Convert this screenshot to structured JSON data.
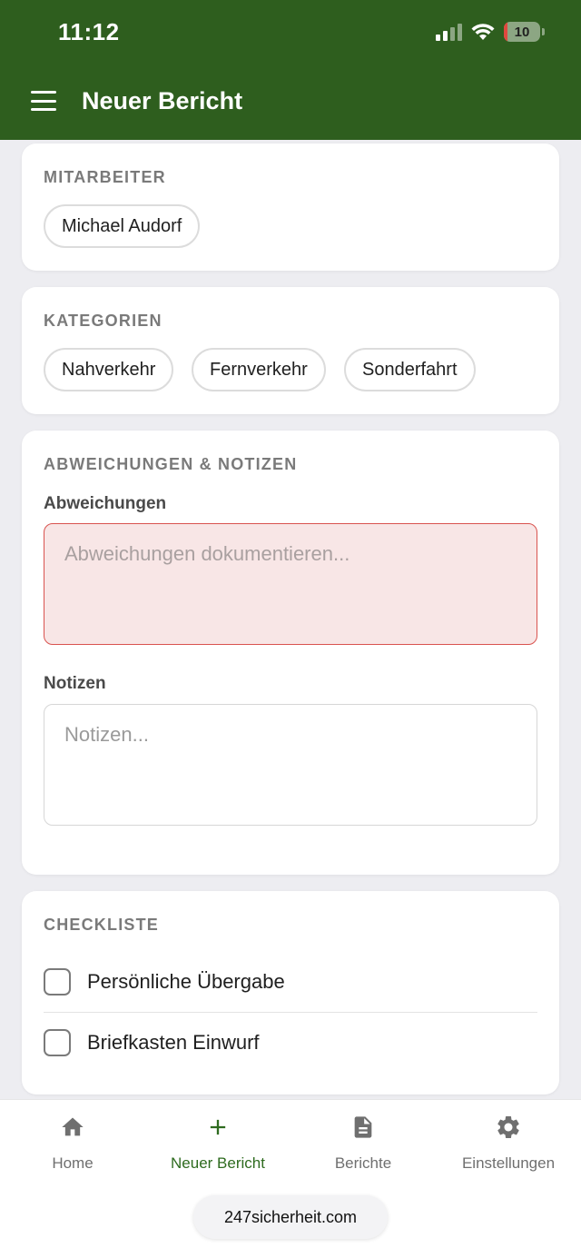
{
  "status_bar": {
    "time": "11:12",
    "battery": "10"
  },
  "header": {
    "title": "Neuer Bericht"
  },
  "mitarbeiter": {
    "title": "MITARBEITER",
    "chips": [
      "Michael Audorf"
    ]
  },
  "kategorien": {
    "title": "KATEGORIEN",
    "chips": [
      "Nahverkehr",
      "Fernverkehr",
      "Sonderfahrt"
    ]
  },
  "abweichungen_notizen": {
    "title": "ABWEICHUNGEN & NOTIZEN",
    "abweichungen_label": "Abweichungen",
    "abweichungen_placeholder": "Abweichungen dokumentieren...",
    "notizen_label": "Notizen",
    "notizen_placeholder": "Notizen..."
  },
  "checkliste": {
    "title": "CHECKLISTE",
    "items": [
      "Persönliche Übergabe",
      "Briefkasten Einwurf"
    ]
  },
  "tabbar": {
    "tabs": [
      {
        "label": "Home",
        "icon": "home-icon"
      },
      {
        "label": "Neuer Bericht",
        "icon": "plus-icon"
      },
      {
        "label": "Berichte",
        "icon": "document-icon"
      },
      {
        "label": "Einstellungen",
        "icon": "gear-icon"
      }
    ]
  },
  "browser": {
    "url": "247sicherheit.com"
  },
  "colors": {
    "header": "#2e5e1e",
    "active_tab": "#2e6b1f",
    "error_bg": "#f8e6e6",
    "error_border": "#d9534f"
  }
}
